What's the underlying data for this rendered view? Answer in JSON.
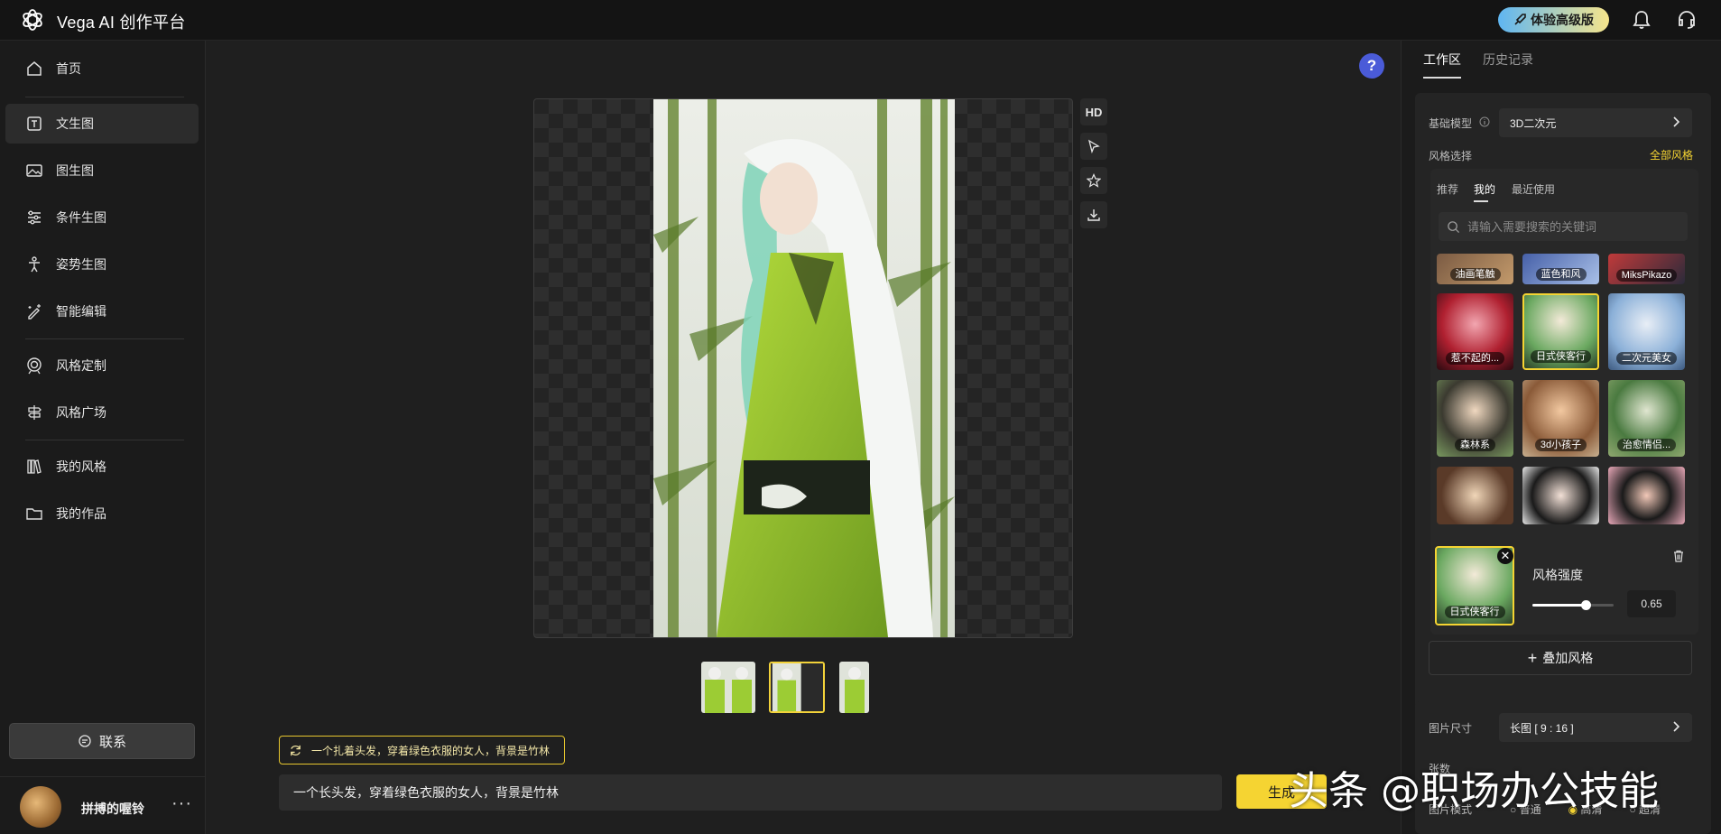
{
  "app": {
    "title": "Vega AI 创作平台",
    "upgrade_label": "体验高级版"
  },
  "sidebar": {
    "items": [
      {
        "label": "首页",
        "icon": "home-icon"
      },
      {
        "label": "文生图",
        "icon": "text-t-icon"
      },
      {
        "label": "图生图",
        "icon": "image-icon"
      },
      {
        "label": "条件生图",
        "icon": "sliders-icon"
      },
      {
        "label": "姿势生图",
        "icon": "pose-figure-icon"
      },
      {
        "label": "智能编辑",
        "icon": "edit-stars-icon"
      },
      {
        "label": "风格定制",
        "icon": "target-icon"
      },
      {
        "label": "风格广场",
        "icon": "signpost-icon"
      },
      {
        "label": "我的风格",
        "icon": "books-icon"
      },
      {
        "label": "我的作品",
        "icon": "folder-icon"
      }
    ],
    "contact_label": "联系",
    "user_name": "拼搏的喔铃",
    "more_label": "···"
  },
  "canvas": {
    "help_label": "?",
    "tools": [
      {
        "label": "HD",
        "icon": "hd-icon"
      },
      {
        "label": "",
        "icon": "select-cursor-icon"
      },
      {
        "label": "",
        "icon": "star-icon"
      },
      {
        "label": "",
        "icon": "download-icon"
      }
    ]
  },
  "prompt": {
    "suggestion": "一个扎着头发，穿着绿色衣服的女人，背景是竹林",
    "value": "一个长头发，穿着绿色衣服的女人，背景是竹林",
    "generate_label": "生成"
  },
  "watermark": "头条 @职场办公技能",
  "right_panel": {
    "tabs": [
      "工作区",
      "历史记录"
    ],
    "base_model_label": "基础模型",
    "base_model_value": "3D二次元",
    "style_select_label": "风格选择",
    "all_styles_label": "全部风格",
    "style_subtabs": [
      "推荐",
      "我的",
      "最近使用"
    ],
    "search_placeholder": "请输入需要搜索的关键词",
    "style_tiles": [
      "油画笔触",
      "蓝色和风",
      "MiksPikazo",
      "惹不起的...",
      "日式侠客行",
      "二次元美女",
      "森林系",
      "3d小孩子",
      "治愈情侣...",
      "",
      "",
      ""
    ],
    "selected_style": "日式侠客行",
    "strength_label": "风格强度",
    "strength_value": "0.65",
    "strength_fraction": 0.65,
    "add_style_label": "叠加风格",
    "image_size_label": "图片尺寸",
    "image_size_value": "长图 [ 9 : 16 ]",
    "count_label": "张数",
    "mode_label": "图片模式",
    "mode_options": [
      "普通",
      "高清",
      "超清"
    ]
  },
  "colors": {
    "accent": "#f5d432",
    "help": "#4a5bd8",
    "bg": "#1f1f1f"
  }
}
